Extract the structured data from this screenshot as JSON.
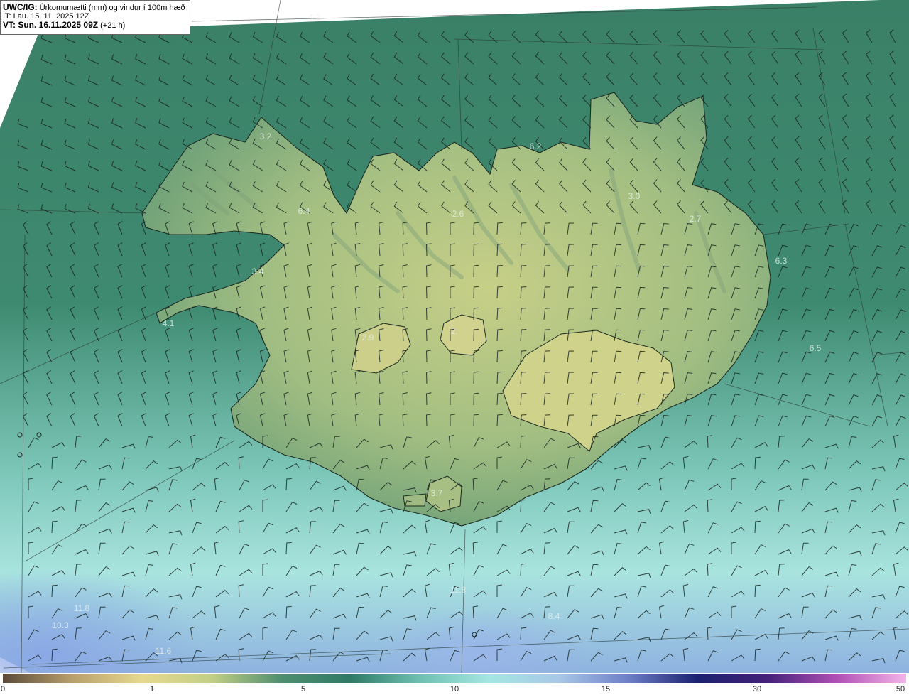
{
  "header": {
    "model_label": "UWC/IG:",
    "title": "Úrkomumætti (mm) og vindur í 100m hæð",
    "init_time": "IT: Lau. 15. 11. 2025 12Z",
    "valid_label": "VT: Sun. 16.11.2025 09Z",
    "lead_time": "(+21 h)"
  },
  "map": {
    "field": "precipitable water",
    "region": "Iceland",
    "land_color": "#a9c58a",
    "sea_color": "#3e8870",
    "value_labels": [
      "4.2",
      "3.2",
      "6.2",
      "3.0",
      "2.7",
      "2.6",
      "6.4",
      "3.4",
      "6.3",
      "4.1",
      "2.9",
      "2.",
      "6.5",
      "3.7",
      "11.8",
      "11.8",
      "10.3",
      "11.6",
      "8.4"
    ]
  },
  "colorbar": {
    "ticks": [
      "0",
      "1",
      "5",
      "10",
      "15",
      "30",
      "50"
    ],
    "colors": [
      "#5b4a3a",
      "#b89f6c",
      "#e6d98e",
      "#c3cf86",
      "#4f8e6f",
      "#2f7a66",
      "#6fc0b3",
      "#a4e6e2",
      "#a8c8e8",
      "#6e7fc8",
      "#1b2070",
      "#44207a",
      "#b04fb5",
      "#f3b4e8"
    ]
  }
}
